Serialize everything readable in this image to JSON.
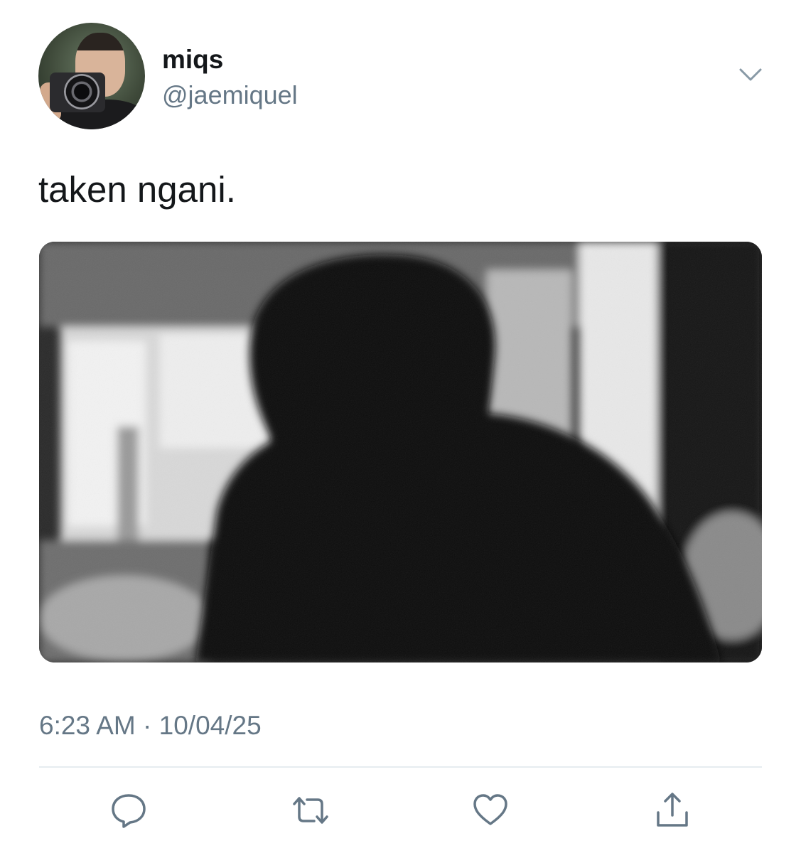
{
  "author": {
    "display_name": "miqs",
    "handle": "@jaemiquel",
    "avatar_icon": "profile-photo"
  },
  "tweet": {
    "text": "taken ngani.",
    "media_description_icon": "photo",
    "timestamp": "6:23 AM · 10/04/25"
  },
  "actions": [
    {
      "name": "reply",
      "icon": "speech-bubble-icon"
    },
    {
      "name": "retweet",
      "icon": "retweet-icon"
    },
    {
      "name": "like",
      "icon": "heart-icon"
    },
    {
      "name": "share",
      "icon": "share-icon"
    }
  ],
  "colors": {
    "text_primary": "#14171a",
    "text_secondary": "#657786",
    "icon": "#657786",
    "divider": "#e6ecf0"
  }
}
